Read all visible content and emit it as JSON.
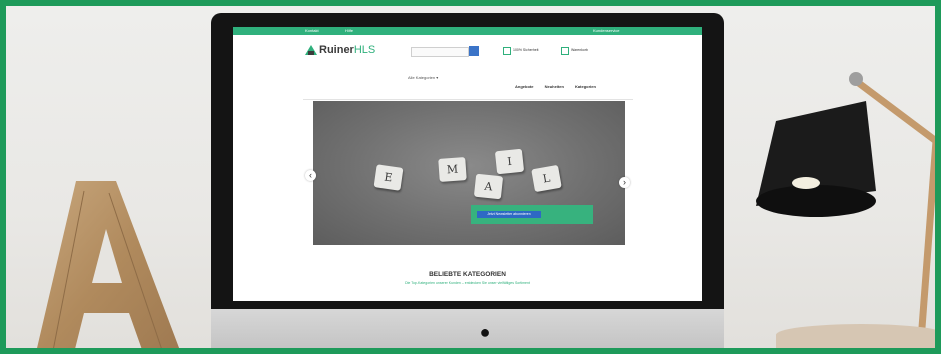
{
  "border_color": "#1e9a5a",
  "site": {
    "topbar_left": [
      "Kontakt",
      "Hilfe"
    ],
    "topbar_right": "Kundenservice",
    "logo_brand": "Ruiner",
    "logo_suffix": "HLS",
    "header_item_1": "100% Sicherheit",
    "header_item_2": "Warenkorb",
    "category_dropdown": "Alle Kategorien",
    "nav": [
      "Angebote",
      "Neuheiten",
      "Kategorien"
    ],
    "slide_tiles": [
      "E",
      "M",
      "A",
      "I",
      "L"
    ],
    "slide_button": "Jetzt Newsletter abonnieren",
    "section_title": "BELIEBTE KATEGORIEN",
    "section_subtitle": "Die Top-Kategorien unserer Kunden – entdecken Sie unser vielfältiges Sortiment"
  },
  "colors": {
    "brand_green": "#2fb07c",
    "button_blue": "#2e69c4"
  }
}
